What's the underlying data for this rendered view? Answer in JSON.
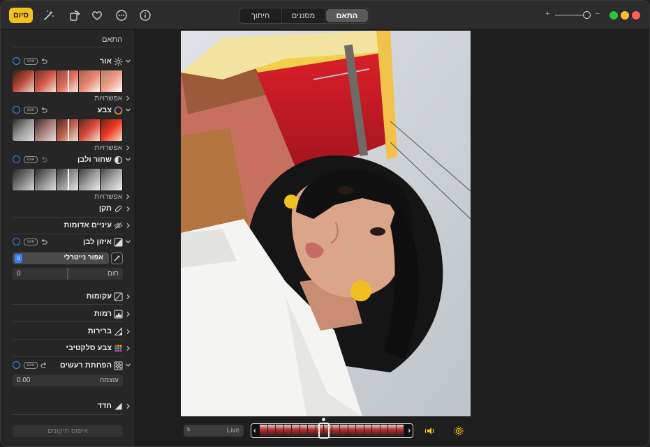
{
  "toolbar": {
    "done_label": "סיום",
    "tabs": [
      {
        "label": "חיתוך",
        "active": false
      },
      {
        "label": "מסננים",
        "active": false
      },
      {
        "label": "התאם",
        "active": true
      }
    ],
    "zoom_plus": "+",
    "zoom_minus": "−",
    "icons": [
      "magic-wand-icon",
      "rotate-icon",
      "heart-icon",
      "more-icon",
      "info-icon"
    ],
    "window_controls": [
      "close",
      "minimize",
      "zoom"
    ]
  },
  "sidebar": {
    "title": "התאם",
    "auto_label": "אוטו",
    "options_label": "אפשרויות",
    "sections": [
      {
        "label": "אור",
        "icon": "sun-icon"
      },
      {
        "label": "צבע",
        "icon": "color-wheel-icon"
      },
      {
        "label": "שחור ולבן",
        "icon": "half-circle-icon"
      },
      {
        "label": "תקן",
        "icon": "bandage-icon"
      },
      {
        "label": "עיניים אדומות",
        "icon": "eye-icon"
      },
      {
        "label": "איזון לבן",
        "icon": "white-balance-icon"
      },
      {
        "label": "עקומות",
        "icon": "curves-icon"
      },
      {
        "label": "רמות",
        "icon": "levels-icon"
      },
      {
        "label": "ברירות",
        "icon": "definition-icon"
      },
      {
        "label": "צבע סלקטיבי",
        "icon": "selective-color-icon"
      },
      {
        "label": "הפחתת רעשים",
        "icon": "noise-icon"
      },
      {
        "label": "חדד",
        "icon": "sharpen-icon"
      }
    ],
    "white_balance": {
      "mode": "אפור נייטרלי",
      "warmth_label": "חום",
      "warmth_value": "0"
    },
    "noise": {
      "amount_label": "עוצמה",
      "amount_value": "0.00"
    },
    "reset_label": "איפוס תיקונים"
  },
  "live": {
    "mode_label": "Live"
  },
  "colors": {
    "accent": "#3b82f6",
    "done_button": "#f4c21a",
    "close": "#fe5f57",
    "minimize": "#febc2e",
    "zoom": "#28c840"
  }
}
